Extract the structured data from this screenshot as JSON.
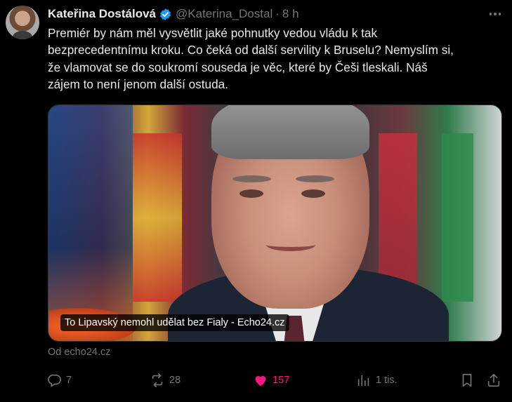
{
  "tweet": {
    "author_name": "Kateřina Dostálová",
    "handle": "@Katerina_Dostal",
    "separator": "·",
    "time": "8 h",
    "text": "Premiér by nám měl vysvětlit jaké pohnutky vedou vládu k tak\nbezprecedentnímu kroku. Co čeká od další servility k Bruselu? Nemyslím si,\nže vlamovat se do soukromí souseda je věc, které by Češi tleskali. Náš\nzájem to není jenom další ostuda."
  },
  "card": {
    "title": "To Lipavský nemohl udělat bez Fialy - Echo24.cz",
    "source": "Od echo24.cz"
  },
  "actions": {
    "replies": "7",
    "retweets": "28",
    "likes": "157",
    "views": "1 tis."
  },
  "colors": {
    "background": "#000000",
    "text": "#e7e9ea",
    "muted": "#71767b",
    "verified": "#1d9bf0",
    "like": "#f91880"
  },
  "icons": [
    "verified-badge-icon",
    "more-icon",
    "reply-icon",
    "retweet-icon",
    "heart-icon",
    "views-icon",
    "bookmark-icon",
    "share-icon"
  ]
}
